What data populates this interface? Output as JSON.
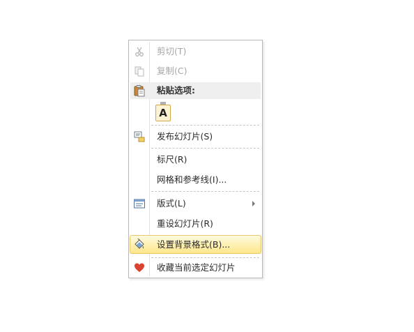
{
  "context_menu": {
    "items": [
      {
        "label": "剪切(T)",
        "state": "disabled",
        "icon": "scissors-icon"
      },
      {
        "label": "复制(C)",
        "state": "disabled",
        "icon": "copy-icon"
      },
      {
        "label": "粘贴选项:",
        "state": "header",
        "icon": "clipboard-icon"
      },
      {
        "paste_option": "A",
        "icon": "paste-keep-text-icon"
      },
      {
        "label": "发布幻灯片(S)",
        "icon": "publish-slides-icon"
      },
      {
        "label": "标尺(R)",
        "icon": ""
      },
      {
        "label": "网格和参考线(I)...",
        "icon": ""
      },
      {
        "label": "版式(L)",
        "icon": "layout-icon",
        "submenu": true
      },
      {
        "label": "重设幻灯片(R)",
        "icon": ""
      },
      {
        "label": "设置背景格式(B)...",
        "icon": "paint-bucket-icon",
        "highlighted": true
      },
      {
        "label": "收藏当前选定幻灯片",
        "icon": "heart-icon"
      }
    ]
  },
  "colors": {
    "highlight_top": "#fffbe0",
    "highlight_bottom": "#fde68a",
    "disabled_text": "#a6a6a6",
    "heart": "#d9432f"
  }
}
